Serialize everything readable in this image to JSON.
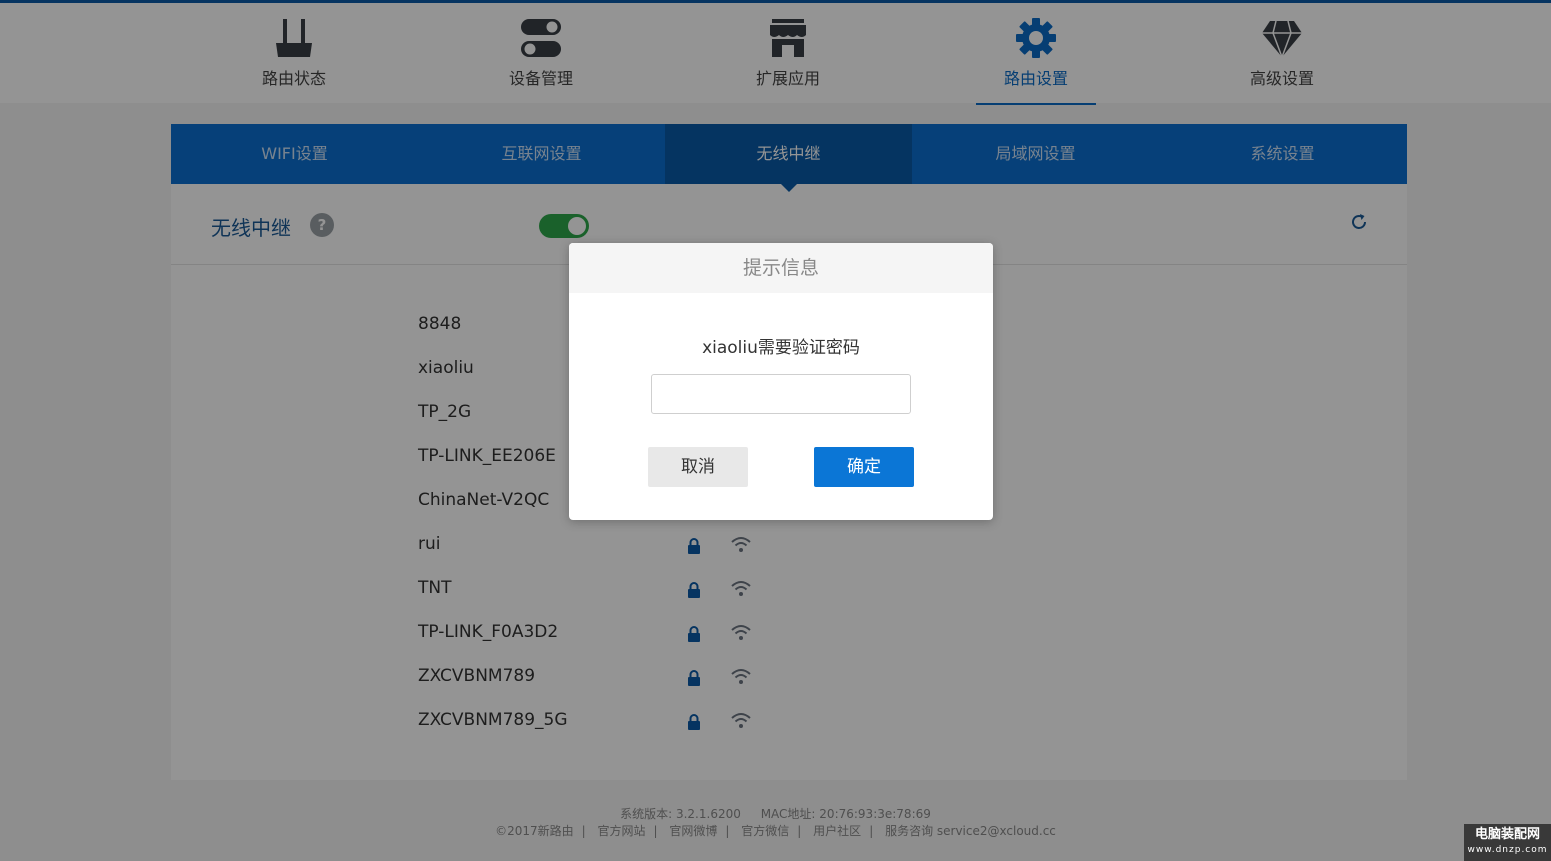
{
  "topnav": {
    "items": [
      {
        "label": "路由状态",
        "icon": "router-icon"
      },
      {
        "label": "设备管理",
        "icon": "toggles-icon"
      },
      {
        "label": "扩展应用",
        "icon": "store-icon"
      },
      {
        "label": "路由设置",
        "icon": "gear-icon",
        "active": true
      },
      {
        "label": "高级设置",
        "icon": "diamond-icon"
      }
    ]
  },
  "tabs": [
    {
      "label": "WIFI设置"
    },
    {
      "label": "互联网设置"
    },
    {
      "label": "无线中继",
      "active": true
    },
    {
      "label": "局域网设置"
    },
    {
      "label": "系统设置"
    }
  ],
  "panel": {
    "title": "无线中继",
    "help": "?",
    "toggle_on": true
  },
  "networks": [
    {
      "name": "8848"
    },
    {
      "name": "xiaoliu"
    },
    {
      "name": "TP_2G"
    },
    {
      "name": "TP-LINK_EE206E"
    },
    {
      "name": "ChinaNet-V2QC"
    },
    {
      "name": "rui"
    },
    {
      "name": "TNT"
    },
    {
      "name": "TP-LINK_F0A3D2"
    },
    {
      "name": "ZXCVBNM789"
    },
    {
      "name": "ZXCVBNM789_5G"
    }
  ],
  "footer": {
    "line1": {
      "version_label": "系统版本:",
      "version": "3.2.1.6200",
      "mac_label": "MAC地址:",
      "mac": "20:76:93:3e:78:69"
    },
    "line2": {
      "copyright": "©2017新路由",
      "links": [
        "官方网站",
        "官网微博",
        "官方微信",
        "用户社区"
      ],
      "service": "服务咨询 service2@xcloud.cc"
    }
  },
  "dialog": {
    "title": "提示信息",
    "message": "xiaoliu需要验证密码",
    "password_value": "",
    "cancel_label": "取消",
    "ok_label": "确定"
  },
  "watermark": {
    "line1": "电脑装配网",
    "line2": "www.dnzp.com"
  },
  "colors": {
    "accent": "#0b6fd0",
    "active_tab": "#0a5aa8",
    "toggle": "#2ea84a",
    "primary_button": "#0b76d6"
  }
}
